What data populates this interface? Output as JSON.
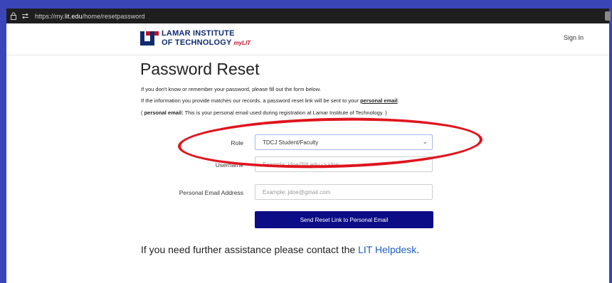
{
  "browser": {
    "url_prefix": "https://my.",
    "url_domain": "lit.edu",
    "url_path": "/home/resetpassword"
  },
  "header": {
    "logo_line1": "LAMAR INSTITUTE",
    "logo_line2": "OF TECHNOLOGY",
    "logo_my": "myLIT",
    "signin": "Sign In"
  },
  "page": {
    "title": "Password Reset",
    "line1": "If you don't know or remember your password, please fill out the form below.",
    "line2_pre": "If the information you provide matches our records, a password reset link will be sent to your ",
    "line2_em": "personal email",
    "line2_post": ".",
    "line3_pre": "( ",
    "line3_bold": "personal email:",
    "line3_post": " This is your personal email used during registration at Lamar Institute of Technology. )"
  },
  "form": {
    "role_label": "Role",
    "role_value": "TDCJ Student/Faculty",
    "username_label": "Username",
    "username_placeholder": "Example: jdoe@lit.edu -> jdoe",
    "email_label": "Personal Email Address",
    "email_placeholder": "Example: jdoe@gmail.com",
    "submit": "Send Reset Link to Personal Email"
  },
  "footer": {
    "assist_pre": "If you need further assistance please contact the ",
    "assist_link": "LIT Helpdesk",
    "assist_post": "."
  },
  "colors": {
    "accent_button": "#0c0c86",
    "highlight_circle": "#e0141d",
    "link": "#1f5fbf",
    "brand_blue": "#0f2b6d",
    "brand_red": "#c0132b"
  },
  "icons": [
    "lock-icon",
    "site-info-icon",
    "chevron-down-icon"
  ]
}
